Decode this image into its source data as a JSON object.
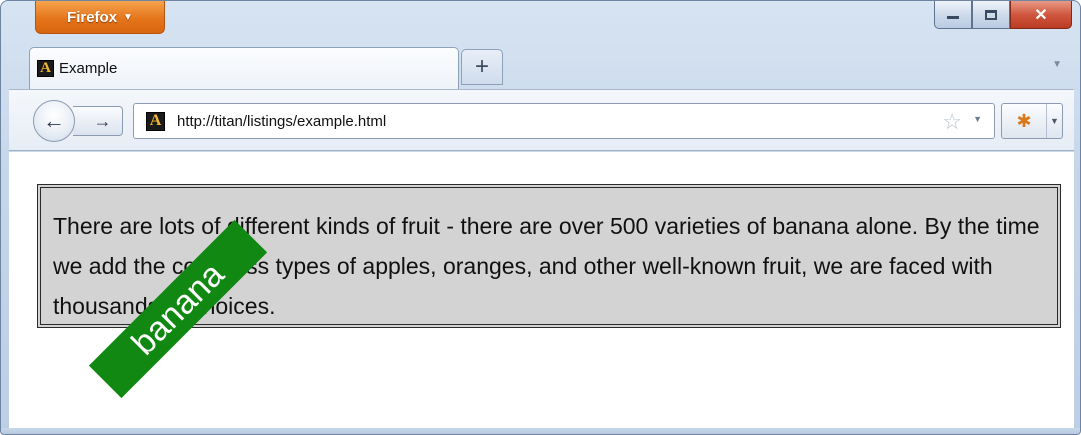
{
  "app_button": {
    "label": "Firefox",
    "icon": "dropdown-triangle"
  },
  "window_controls": {
    "minimize": "minimize",
    "maximize": "maximize",
    "close": "x"
  },
  "tabs": [
    {
      "title": "Example",
      "icon": "A"
    }
  ],
  "new_tab_label": "+",
  "nav": {
    "back_glyph": "←",
    "forward_glyph": "→",
    "url": "http://titan/listings/example.html",
    "site_icon": "A"
  },
  "page": {
    "paragraph": "There are lots of different kinds of fruit - there are over 500 varieties of banana alone. By the time we add the countless types of apples, oranges, and other well-known fruit, we are faced with thousands of choices.",
    "rotated_label": "banana"
  },
  "colors": {
    "app_button": "#e4751b",
    "paragraph_background": "#d3d3d3",
    "banana_background": "#118811",
    "close_button": "#c7452c"
  }
}
